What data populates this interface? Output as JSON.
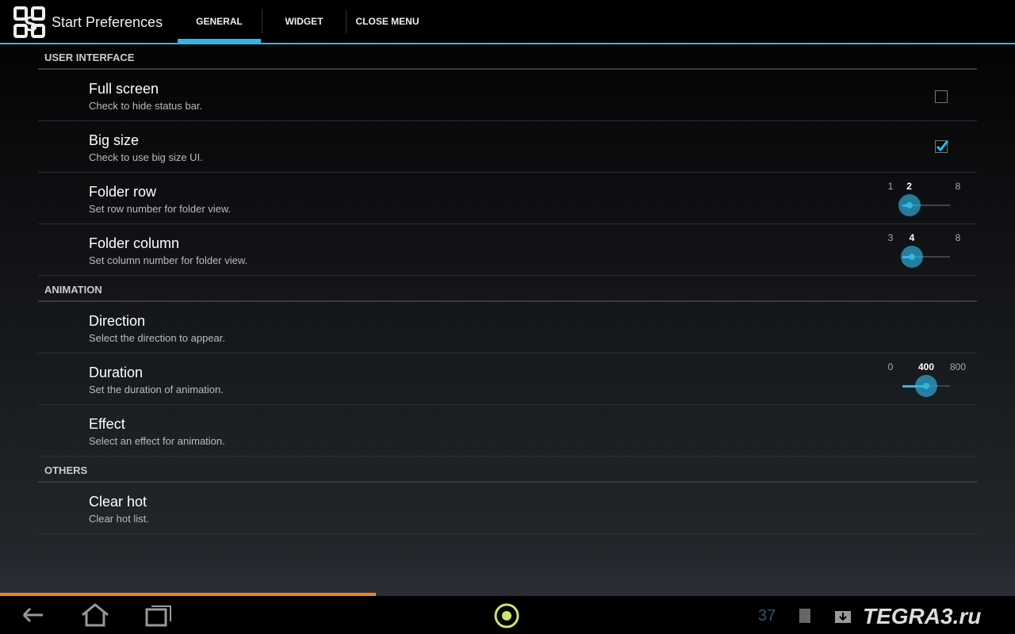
{
  "app": {
    "title": "Start Preferences"
  },
  "tabs": [
    {
      "label": "GENERAL",
      "active": true
    },
    {
      "label": "WIDGET"
    },
    {
      "label": "CLOSE MENU"
    }
  ],
  "accent": "#33b5e5",
  "sections": [
    {
      "title": "USER INTERFACE",
      "items": [
        {
          "title": "Full screen",
          "summary": "Check to hide status bar.",
          "checked": false
        },
        {
          "title": "Big size",
          "summary": "Check to use big size UI.",
          "checked": true
        },
        {
          "title": "Folder row",
          "summary": "Set row number for folder view.",
          "min": "1",
          "value": "2",
          "max": "8"
        },
        {
          "title": "Folder column",
          "summary": "Set column number for folder view.",
          "min": "3",
          "value": "4",
          "max": "8"
        }
      ]
    },
    {
      "title": "ANIMATION",
      "items": [
        {
          "title": "Direction",
          "summary": "Select the direction to appear."
        },
        {
          "title": "Duration",
          "summary": "Set the duration of animation.",
          "min": "0",
          "value": "400",
          "max": "800"
        },
        {
          "title": "Effect",
          "summary": "Select an effect for animation."
        }
      ]
    },
    {
      "title": "OTHERS",
      "items": [
        {
          "title": "Clear hot",
          "summary": "Clear hot list."
        }
      ]
    }
  ],
  "system_bar": {
    "time": "37",
    "progress_percent": 37,
    "watermark": "TEGRA3.ru"
  }
}
